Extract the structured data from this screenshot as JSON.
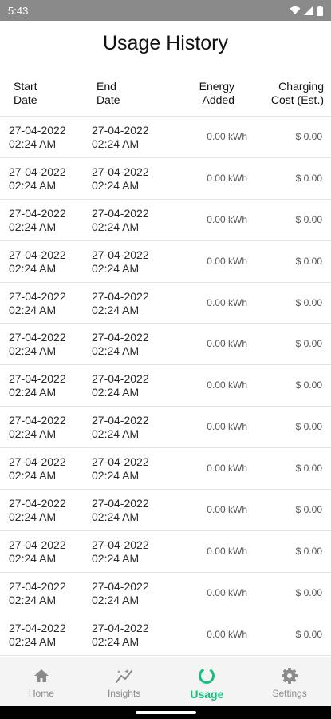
{
  "status_bar": {
    "time": "5:43"
  },
  "page": {
    "title": "Usage History"
  },
  "table": {
    "headers": {
      "start_line1": "Start",
      "start_line2": "Date",
      "end_line1": "End",
      "end_line2": "Date",
      "energy_line1": "Energy",
      "energy_line2": "Added",
      "cost_line1": "Charging",
      "cost_line2": "Cost (Est.)"
    },
    "rows": [
      {
        "start_date": "27-04-2022",
        "start_time": "02:24 AM",
        "end_date": "27-04-2022",
        "end_time": "02:24 AM",
        "energy": "0.00 kWh",
        "cost": "$ 0.00"
      },
      {
        "start_date": "27-04-2022",
        "start_time": "02:24 AM",
        "end_date": "27-04-2022",
        "end_time": "02:24 AM",
        "energy": "0.00 kWh",
        "cost": "$ 0.00"
      },
      {
        "start_date": "27-04-2022",
        "start_time": "02:24 AM",
        "end_date": "27-04-2022",
        "end_time": "02:24 AM",
        "energy": "0.00 kWh",
        "cost": "$ 0.00"
      },
      {
        "start_date": "27-04-2022",
        "start_time": "02:24 AM",
        "end_date": "27-04-2022",
        "end_time": "02:24 AM",
        "energy": "0.00 kWh",
        "cost": "$ 0.00"
      },
      {
        "start_date": "27-04-2022",
        "start_time": "02:24 AM",
        "end_date": "27-04-2022",
        "end_time": "02:24 AM",
        "energy": "0.00 kWh",
        "cost": "$ 0.00"
      },
      {
        "start_date": "27-04-2022",
        "start_time": "02:24 AM",
        "end_date": "27-04-2022",
        "end_time": "02:24 AM",
        "energy": "0.00 kWh",
        "cost": "$ 0.00"
      },
      {
        "start_date": "27-04-2022",
        "start_time": "02:24 AM",
        "end_date": "27-04-2022",
        "end_time": "02:24 AM",
        "energy": "0.00 kWh",
        "cost": "$ 0.00"
      },
      {
        "start_date": "27-04-2022",
        "start_time": "02:24 AM",
        "end_date": "27-04-2022",
        "end_time": "02:24 AM",
        "energy": "0.00 kWh",
        "cost": "$ 0.00"
      },
      {
        "start_date": "27-04-2022",
        "start_time": "02:24 AM",
        "end_date": "27-04-2022",
        "end_time": "02:24 AM",
        "energy": "0.00 kWh",
        "cost": "$ 0.00"
      },
      {
        "start_date": "27-04-2022",
        "start_time": "02:24 AM",
        "end_date": "27-04-2022",
        "end_time": "02:24 AM",
        "energy": "0.00 kWh",
        "cost": "$ 0.00"
      },
      {
        "start_date": "27-04-2022",
        "start_time": "02:24 AM",
        "end_date": "27-04-2022",
        "end_time": "02:24 AM",
        "energy": "0.00 kWh",
        "cost": "$ 0.00"
      },
      {
        "start_date": "27-04-2022",
        "start_time": "02:24 AM",
        "end_date": "27-04-2022",
        "end_time": "02:24 AM",
        "energy": "0.00 kWh",
        "cost": "$ 0.00"
      },
      {
        "start_date": "27-04-2022",
        "start_time": "02:24 AM",
        "end_date": "27-04-2022",
        "end_time": "02:24 AM",
        "energy": "0.00 kWh",
        "cost": "$ 0.00"
      }
    ]
  },
  "bottom_nav": {
    "items": [
      {
        "label": "Home",
        "icon": "home-icon"
      },
      {
        "label": "Insights",
        "icon": "insights-icon"
      },
      {
        "label": "Usage",
        "icon": "usage-ring-icon",
        "active": true
      },
      {
        "label": "Settings",
        "icon": "gear-icon"
      }
    ],
    "accent_color": "#13c07c"
  }
}
